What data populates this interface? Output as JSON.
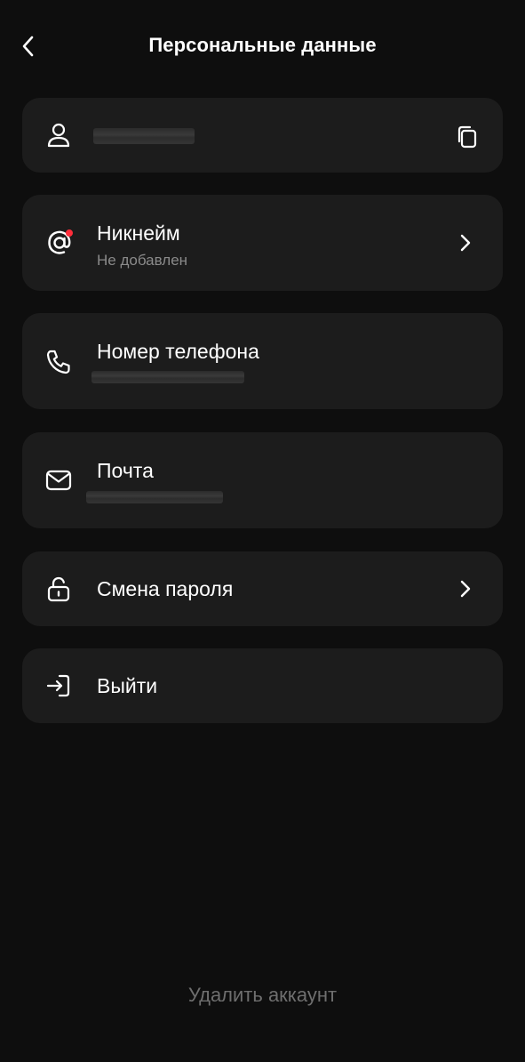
{
  "header": {
    "title": "Персональные данные",
    "back_icon": "chevron-left-icon"
  },
  "profile": {
    "icon": "user-icon",
    "name_hidden": true,
    "copy_icon": "copy-icon"
  },
  "nickname": {
    "icon": "at-sign-icon",
    "label": "Никнейм",
    "status": "Не добавлен",
    "has_badge": true,
    "badge_color": "#ff2d3a"
  },
  "phone": {
    "icon": "phone-icon",
    "label": "Номер телефона",
    "value_hidden": true
  },
  "email": {
    "icon": "mail-icon",
    "label": "Почта",
    "value_hidden": true
  },
  "password": {
    "icon": "unlock-icon",
    "label": "Смена пароля"
  },
  "logout": {
    "icon": "sign-in-icon",
    "label": "Выйти"
  },
  "footer": {
    "delete_label": "Удалить аккаунт"
  },
  "colors": {
    "background": "#0e0e0e",
    "card": "#1c1c1c",
    "text": "#ffffff",
    "muted": "#8a8a8a",
    "danger_link": "#6e6e6e"
  }
}
